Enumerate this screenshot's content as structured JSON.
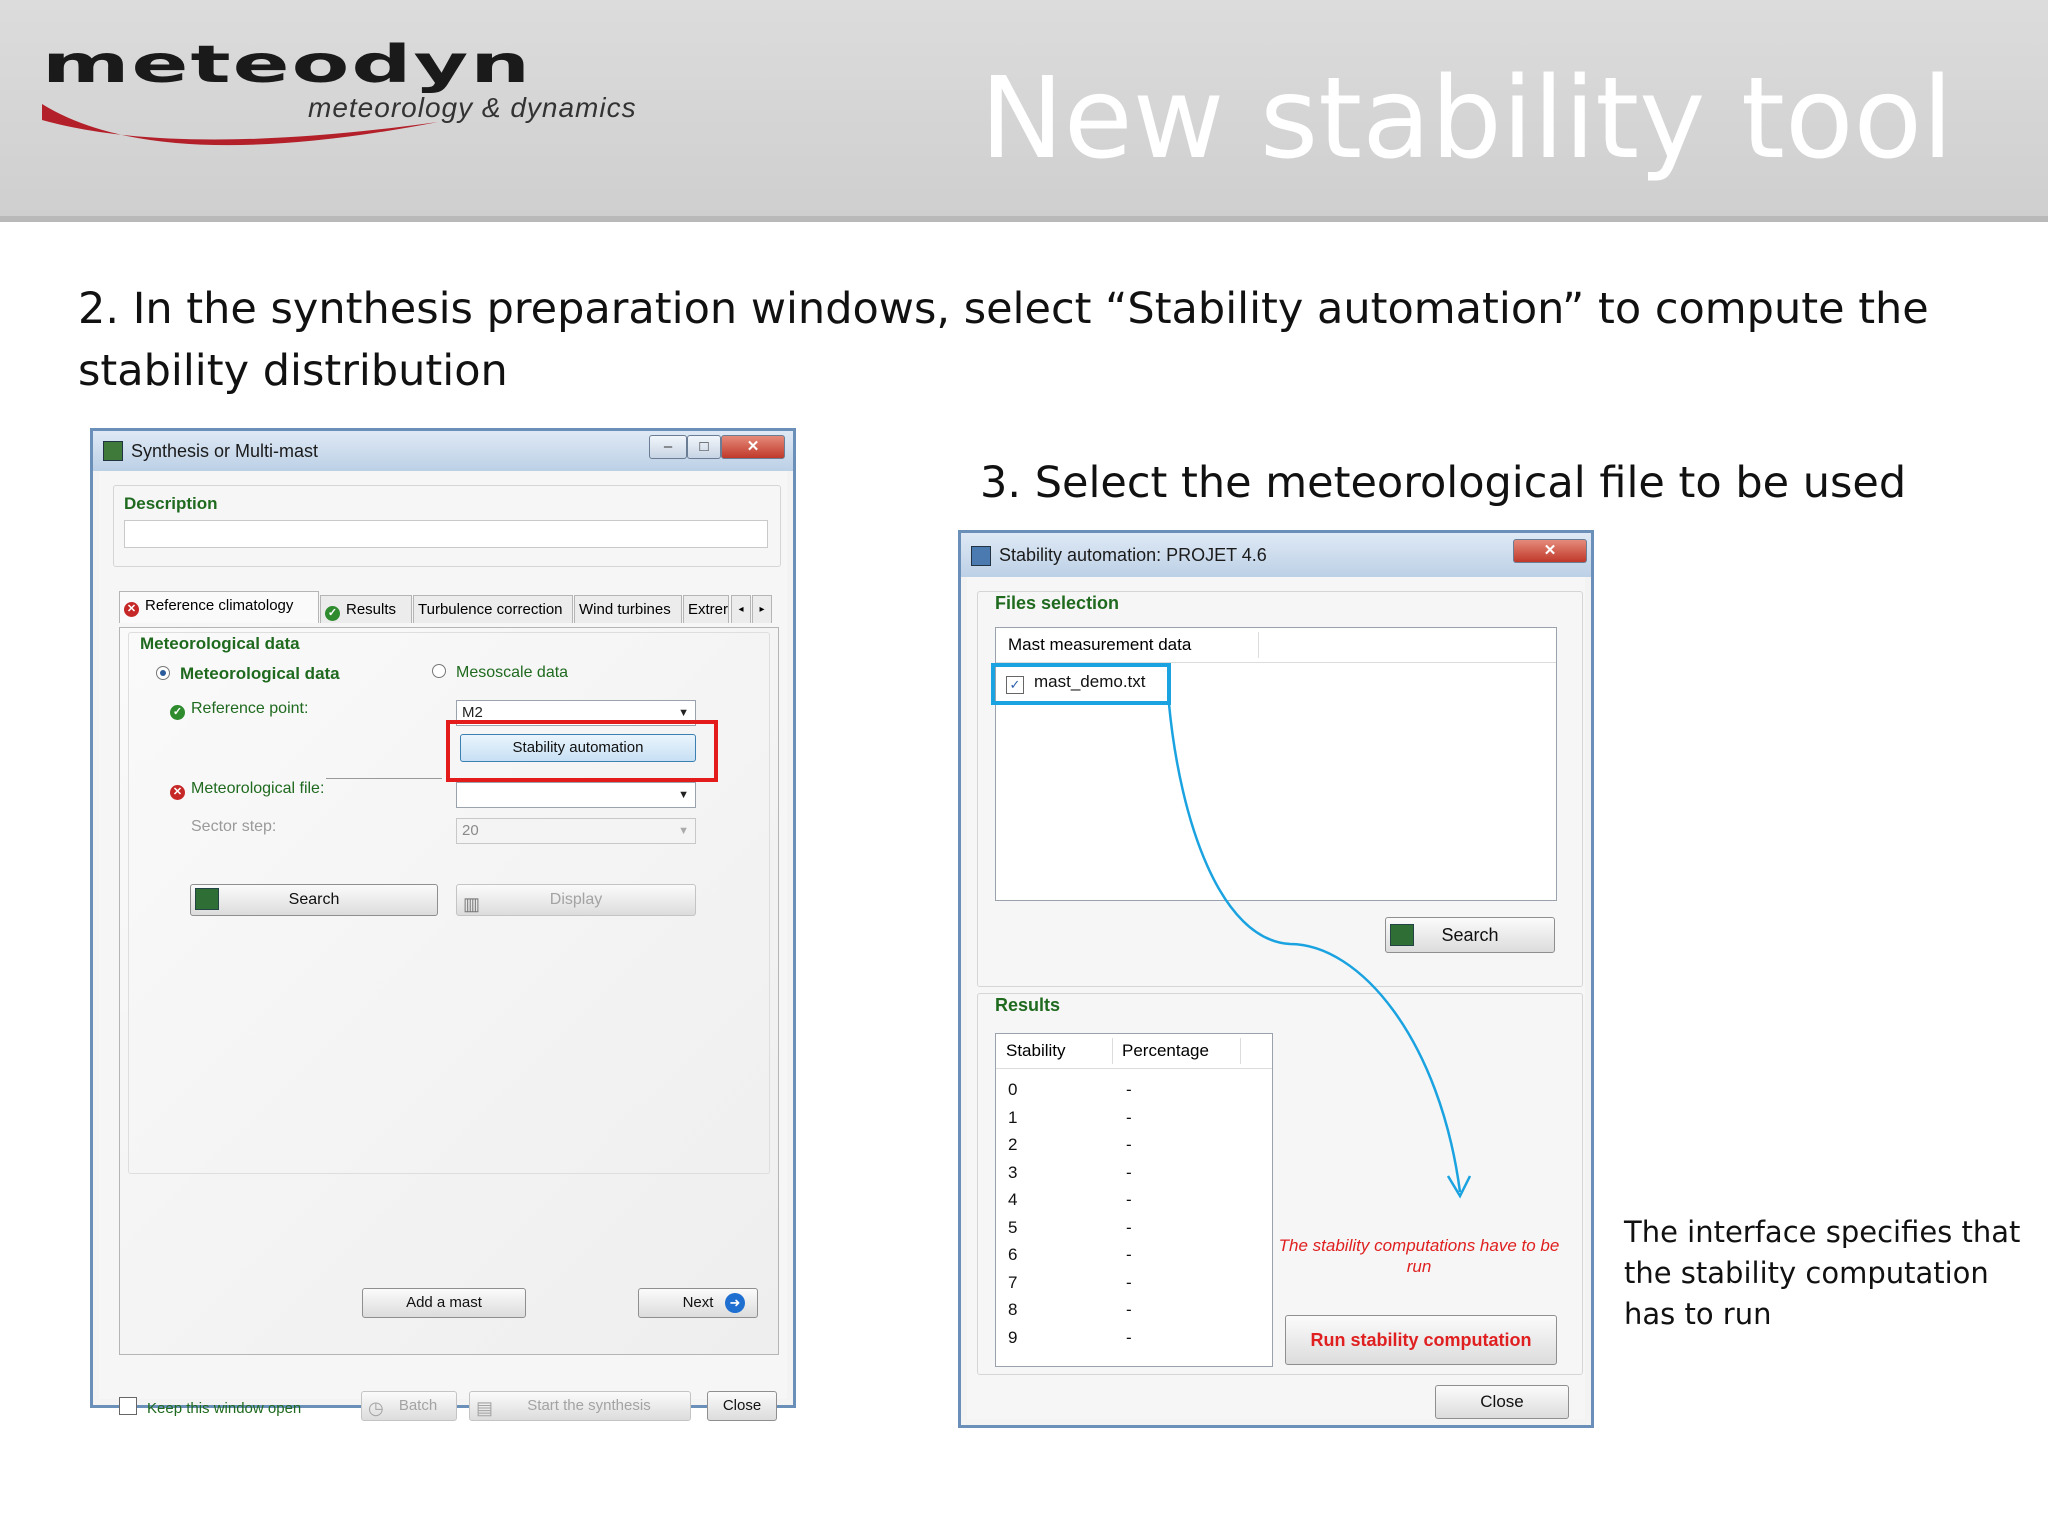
{
  "header": {
    "logo_word": "meteodyn",
    "logo_tagline": "meteorology & dynamics",
    "title": "New stability tool"
  },
  "captions": {
    "step2": "2. In the synthesis preparation windows, select “Stability automation” to compute the stability distribution",
    "step3": "3. Select the meteorological file to be used",
    "note": "The interface specifies that the stability computation has to run"
  },
  "window1": {
    "title": "Synthesis or Multi-mast",
    "description_label": "Description",
    "description_value": "",
    "tabs": [
      "Reference climatology",
      "Results",
      "Turbulence correction",
      "Wind turbines",
      "Extrer"
    ],
    "section_label": "Meteorological data",
    "radio_met": "Meteorological data",
    "radio_meso": "Mesoscale data",
    "reference_point_label": "Reference point:",
    "reference_point_value": "M2",
    "stability_button": "Stability automation",
    "met_file_label": "Meteorological file:",
    "met_file_value": "",
    "sector_step_label": "Sector step:",
    "sector_step_value": "20",
    "search_button": "Search",
    "display_button": "Display",
    "add_mast_button": "Add a mast",
    "next_button": "Next",
    "keep_open_label": "Keep this window open",
    "batch_button": "Batch",
    "start_synthesis_button": "Start the synthesis",
    "close_button": "Close"
  },
  "window2": {
    "title": "Stability automation: PROJET 4.6",
    "files_group": "Files selection",
    "list_header": "Mast measurement data",
    "file_item": "mast_demo.txt",
    "file_checked": true,
    "search_button": "Search",
    "results_group": "Results",
    "col_stability": "Stability",
    "col_percentage": "Percentage",
    "results": [
      {
        "stability": "0",
        "percentage": "-"
      },
      {
        "stability": "1",
        "percentage": "-"
      },
      {
        "stability": "2",
        "percentage": "-"
      },
      {
        "stability": "3",
        "percentage": "-"
      },
      {
        "stability": "4",
        "percentage": "-"
      },
      {
        "stability": "5",
        "percentage": "-"
      },
      {
        "stability": "6",
        "percentage": "-"
      },
      {
        "stability": "7",
        "percentage": "-"
      },
      {
        "stability": "8",
        "percentage": "-"
      },
      {
        "stability": "9",
        "percentage": "-"
      }
    ],
    "warning": "The stability computations have to be run",
    "run_button": "Run stability computation",
    "close_button": "Close"
  },
  "colors": {
    "highlight_red": "#e31b1b",
    "highlight_blue": "#1aa3e0",
    "label_green": "#1f6a1f",
    "warning_red": "#e02020"
  },
  "icons": [
    "close-icon",
    "minimize-icon",
    "maximize-icon",
    "error-icon",
    "check-icon",
    "map-icon",
    "chart-icon",
    "clock-icon",
    "next-arrow-icon",
    "app-icon"
  ]
}
